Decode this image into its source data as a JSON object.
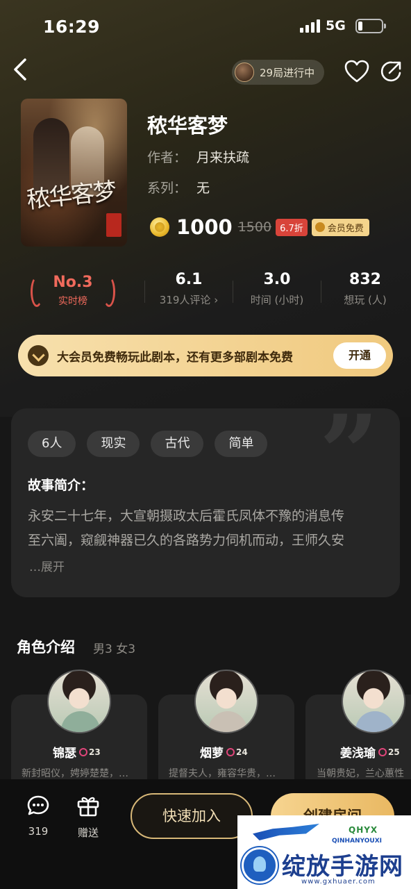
{
  "status_bar": {
    "time": "16:29",
    "network": "5G"
  },
  "nav": {
    "progress_text": "29局进行中"
  },
  "script": {
    "cover_title": "秾华客梦",
    "title": "秾华客梦",
    "author_label": "作者：",
    "author": "月来扶疏",
    "series_label": "系列：",
    "series": "无",
    "price": "1000",
    "original_price": "1500",
    "discount": "6.7折",
    "vip_free_tag": "会员免费"
  },
  "stats": {
    "rank": {
      "value": "No.3",
      "label": "实时榜"
    },
    "rating": {
      "value": "6.1",
      "label": "319人评论 ›"
    },
    "duration": {
      "value": "3.0",
      "label": "时间 (小时)"
    },
    "wants": {
      "value": "832",
      "label": "想玩 (人)"
    }
  },
  "vip_banner": {
    "text": "大会员免费畅玩此剧本，还有更多部剧本免费",
    "button": "开通"
  },
  "story": {
    "tags": [
      "6人",
      "现实",
      "古代",
      "简单"
    ],
    "heading": "故事简介：",
    "line1": "永安二十七年，大宣朝摄政太后霍氏凤体不豫的消息传",
    "line2": "至六阖，窥觎神器已久的各路势力伺机而动，王师久安",
    "expand": "…展开"
  },
  "roles": {
    "heading": "角色介绍",
    "gender_count": "男3 女3",
    "items": [
      {
        "name": "锦瑟",
        "count": "23",
        "desc": "新封昭仪，娉婷楚楚，…"
      },
      {
        "name": "烟萝",
        "count": "24",
        "desc": "提督夫人，雍容华贵，…"
      },
      {
        "name": "姜浅瑜",
        "count": "25",
        "desc": "当朝贵妃，兰心蕙性"
      }
    ]
  },
  "bottom_bar": {
    "comments_count": "319",
    "gift_label": "赠送",
    "quick_join": "快速加入",
    "create_room": "创建房间"
  },
  "watermark": {
    "mark": "QHYX",
    "sub": "QINHANYOUXI",
    "name": "绽放手游网",
    "url": "www.gxhuaer.com"
  },
  "colors": {
    "accent_gold": "#f0c97e",
    "rank_red": "#f06a5c",
    "discount_red": "#d8443a",
    "background": "#171717",
    "card": "#262626"
  }
}
